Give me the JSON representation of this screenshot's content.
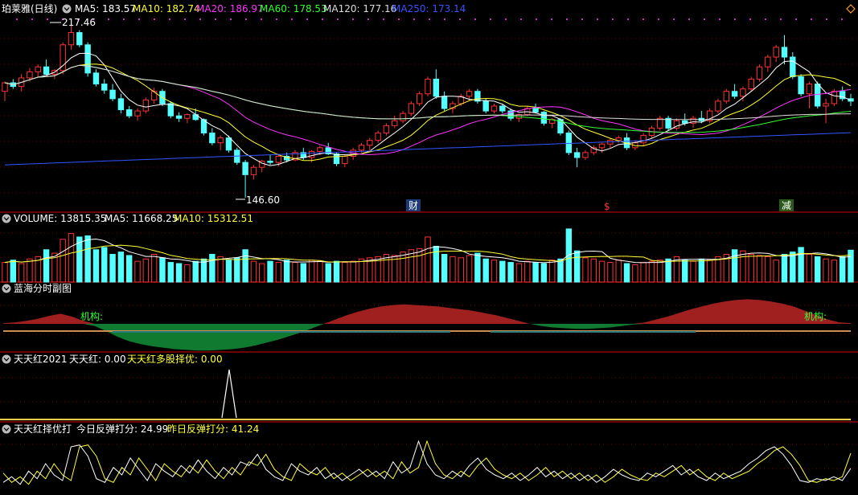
{
  "panels": {
    "price": {
      "name": "珀莱雅(日线)",
      "ma": [
        {
          "label": "MA5: 183.57",
          "color": "#ffffff"
        },
        {
          "label": "MA10: 182.74",
          "color": "#ffff33"
        },
        {
          "label": "MA20: 186.97",
          "color": "#ff33ff"
        },
        {
          "label": "MA60: 178.53",
          "color": "#33ff33"
        },
        {
          "label": "MA120: 177.16",
          "color": "#dddddd"
        },
        {
          "label": "MA250: 173.14",
          "color": "#3355ff"
        }
      ],
      "high_label": "217.46",
      "low_label": "146.60",
      "events": [
        "财",
        "$",
        "减"
      ]
    },
    "volume": {
      "name": "VOLUME: 13815.35",
      "ma5": "MA5: 11668.25",
      "ma10": "MA10: 15312.51"
    },
    "lanhai": {
      "name": "蓝海分时副图",
      "tag_left": "机构:",
      "tag_right": "机构:"
    },
    "tth": {
      "name": "天天红2021",
      "v1": "天天红: 0.00",
      "v2": "天天红多股择优: 0.00"
    },
    "ttx": {
      "name": "天天红择优打",
      "v1": "今日反弹打分: 24.99",
      "v2": "昨日反弹打分: 41.24"
    }
  },
  "colors": {
    "up": "#ff3232",
    "down": "#54ffff",
    "grid": "#7a0000",
    "ma5": "#ffffff",
    "ma10": "#ffff33",
    "ma20": "#ff33ff",
    "ma60": "#33ff33",
    "ma120": "#dddddd",
    "ma250": "#3355ff",
    "red_area": "#a02020",
    "green_area": "#107a30"
  },
  "chart_data": {
    "type": "candlestick",
    "ylim": [
      146.6,
      217.46
    ],
    "candles": [
      [
        190.0,
        194.0,
        186.0,
        193.5
      ],
      [
        193.5,
        195.0,
        191.0,
        192.0
      ],
      [
        192.0,
        197.0,
        190.0,
        195.5
      ],
      [
        195.5,
        199.5,
        194.0,
        198.0
      ],
      [
        198.0,
        201.0,
        196.0,
        200.0
      ],
      [
        200.0,
        203.0,
        196.5,
        197.0
      ],
      [
        197.0,
        199.0,
        195.0,
        198.5
      ],
      [
        198.5,
        210.0,
        197.0,
        209.0
      ],
      [
        209.0,
        217.46,
        207.0,
        214.0
      ],
      [
        214.0,
        215.0,
        208.0,
        209.0
      ],
      [
        209.0,
        210.0,
        196.0,
        197.5
      ],
      [
        197.5,
        199.0,
        192.0,
        193.0
      ],
      [
        193.0,
        195.0,
        189.0,
        190.5
      ],
      [
        190.5,
        193.0,
        186.0,
        187.0
      ],
      [
        187.0,
        189.0,
        181.0,
        182.5
      ],
      [
        182.5,
        184.0,
        179.0,
        180.0
      ],
      [
        180.0,
        183.0,
        178.0,
        182.0
      ],
      [
        182.0,
        187.5,
        181.0,
        186.5
      ],
      [
        186.5,
        191.5,
        185.0,
        190.0
      ],
      [
        190.0,
        191.0,
        184.0,
        185.0
      ],
      [
        185.0,
        186.0,
        179.0,
        180.0
      ],
      [
        180.0,
        181.5,
        177.5,
        179.0
      ],
      [
        179.0,
        181.0,
        177.0,
        180.5
      ],
      [
        180.5,
        183.0,
        178.0,
        178.5
      ],
      [
        178.5,
        179.0,
        172.0,
        173.0
      ],
      [
        173.0,
        175.0,
        168.0,
        169.0
      ],
      [
        169.0,
        172.0,
        166.0,
        171.0
      ],
      [
        171.0,
        172.0,
        165.0,
        166.0
      ],
      [
        166.0,
        167.0,
        160.0,
        161.0
      ],
      [
        161.0,
        162.0,
        146.6,
        156.0
      ],
      [
        156.0,
        160.0,
        154.0,
        159.0
      ],
      [
        159.0,
        162.0,
        157.0,
        161.5
      ],
      [
        161.5,
        164.0,
        160.0,
        161.0
      ],
      [
        161.0,
        164.5,
        159.5,
        163.5
      ],
      [
        163.5,
        165.0,
        161.0,
        162.0
      ],
      [
        162.0,
        166.0,
        161.5,
        165.0
      ],
      [
        165.0,
        167.0,
        162.0,
        163.0
      ],
      [
        163.0,
        166.0,
        161.0,
        165.5
      ],
      [
        165.5,
        168.0,
        164.0,
        167.0
      ],
      [
        167.0,
        169.0,
        164.0,
        164.5
      ],
      [
        164.5,
        165.0,
        159.5,
        160.5
      ],
      [
        160.5,
        164.0,
        159.0,
        163.5
      ],
      [
        163.5,
        167.0,
        162.0,
        166.0
      ],
      [
        166.0,
        169.0,
        165.0,
        168.0
      ],
      [
        168.0,
        171.0,
        166.0,
        170.0
      ],
      [
        170.0,
        174.0,
        169.0,
        173.0
      ],
      [
        173.0,
        177.0,
        172.0,
        176.0
      ],
      [
        176.0,
        180.0,
        175.0,
        178.0
      ],
      [
        178.0,
        182.0,
        177.0,
        181.0
      ],
      [
        181.0,
        186.0,
        180.0,
        185.0
      ],
      [
        185.0,
        190.0,
        184.0,
        189.0
      ],
      [
        189.0,
        196.0,
        188.0,
        195.0
      ],
      [
        195.0,
        199.0,
        187.0,
        188.0
      ],
      [
        188.0,
        190.0,
        182.0,
        183.0
      ],
      [
        183.0,
        186.0,
        181.0,
        185.0
      ],
      [
        185.0,
        189.0,
        184.0,
        188.0
      ],
      [
        188.0,
        191.0,
        186.0,
        190.0
      ],
      [
        190.0,
        191.0,
        185.0,
        186.0
      ],
      [
        186.0,
        187.0,
        181.0,
        182.0
      ],
      [
        182.0,
        185.0,
        181.0,
        184.0
      ],
      [
        184.0,
        185.0,
        181.0,
        182.0
      ],
      [
        182.0,
        183.0,
        178.0,
        179.0
      ],
      [
        179.0,
        181.0,
        177.5,
        180.5
      ],
      [
        180.5,
        184.0,
        180.0,
        183.0
      ],
      [
        183.0,
        185.0,
        181.0,
        181.5
      ],
      [
        181.5,
        182.0,
        176.0,
        177.0
      ],
      [
        177.0,
        179.0,
        175.0,
        178.5
      ],
      [
        178.5,
        179.0,
        172.0,
        173.0
      ],
      [
        173.0,
        174.0,
        164.0,
        165.0
      ],
      [
        165.0,
        167.0,
        159.0,
        163.0
      ],
      [
        163.0,
        166.0,
        162.0,
        165.0
      ],
      [
        165.0,
        168.0,
        164.0,
        167.0
      ],
      [
        167.0,
        169.0,
        165.0,
        168.5
      ],
      [
        168.5,
        171.0,
        167.0,
        170.0
      ],
      [
        170.0,
        172.0,
        169.0,
        171.0
      ],
      [
        171.0,
        173.0,
        166.0,
        167.0
      ],
      [
        167.0,
        170.0,
        166.0,
        169.0
      ],
      [
        169.0,
        173.0,
        168.0,
        172.0
      ],
      [
        172.0,
        176.0,
        171.0,
        175.0
      ],
      [
        175.0,
        180.0,
        174.0,
        179.0
      ],
      [
        179.0,
        180.0,
        174.0,
        175.0
      ],
      [
        175.0,
        179.0,
        174.0,
        178.0
      ],
      [
        178.0,
        181.0,
        176.0,
        177.0
      ],
      [
        177.0,
        180.0,
        175.0,
        179.0
      ],
      [
        179.0,
        182.0,
        177.0,
        178.0
      ],
      [
        178.0,
        183.0,
        177.0,
        182.0
      ],
      [
        182.0,
        187.0,
        181.0,
        186.0
      ],
      [
        186.0,
        191.0,
        185.0,
        190.0
      ],
      [
        190.0,
        193.0,
        187.0,
        188.0
      ],
      [
        188.0,
        192.0,
        186.0,
        191.0
      ],
      [
        191.0,
        196.0,
        190.0,
        195.0
      ],
      [
        195.0,
        201.0,
        194.0,
        200.0
      ],
      [
        200.0,
        205.0,
        198.0,
        204.0
      ],
      [
        204.0,
        209.0,
        202.0,
        208.0
      ],
      [
        208.0,
        213.0,
        201.0,
        204.0
      ],
      [
        204.0,
        206.0,
        195.0,
        196.0
      ],
      [
        196.0,
        197.0,
        188.0,
        189.0
      ],
      [
        189.0,
        194.0,
        183.0,
        193.0
      ],
      [
        193.0,
        194.0,
        183.0,
        184.0
      ],
      [
        184.0,
        187.0,
        177.0,
        185.0
      ],
      [
        185.0,
        191.0,
        184.0,
        190.0
      ],
      [
        190.0,
        192.0,
        186.0,
        187.0
      ],
      [
        187.0,
        189.0,
        184.0,
        186.0
      ]
    ],
    "volume": [
      8500,
      9500,
      8000,
      10000,
      11000,
      14000,
      12500,
      18500,
      21000,
      19500,
      20000,
      14000,
      15000,
      12000,
      13000,
      11500,
      9000,
      10000,
      12000,
      10500,
      8500,
      8000,
      7500,
      9000,
      10000,
      12000,
      11000,
      9500,
      10500,
      14000,
      9000,
      8000,
      9000,
      8500,
      9500,
      8500,
      8000,
      9500,
      9000,
      8000,
      9000,
      8500,
      9000,
      10000,
      10500,
      11000,
      12000,
      11500,
      13000,
      14000,
      14500,
      19500,
      15500,
      12000,
      11000,
      10500,
      11500,
      12500,
      10000,
      9500,
      9000,
      8500,
      8000,
      9000,
      8500,
      8000,
      9500,
      10000,
      23000,
      13500,
      10500,
      10000,
      9000,
      8500,
      9500,
      8000,
      7500,
      8500,
      9000,
      9500,
      10000,
      11000,
      9500,
      9000,
      10000,
      9500,
      11000,
      12000,
      14000,
      13500,
      12000,
      11500,
      11000,
      9500,
      12000,
      13000,
      15000,
      12000,
      11000,
      10000,
      9500,
      11000,
      13815.35
    ],
    "lanhai": [
      1,
      2,
      4,
      7,
      11,
      14,
      10,
      4,
      -3,
      -10,
      -18,
      -24,
      -28,
      -31,
      -33,
      -35,
      -36,
      -37,
      -37,
      -36,
      -35,
      -33,
      -30,
      -26,
      -22,
      -17,
      -12,
      -6,
      0,
      6,
      12,
      17,
      21,
      24,
      26,
      27,
      26,
      25,
      24,
      22,
      20,
      18,
      15,
      12,
      8,
      4,
      0,
      -3,
      -5,
      -6,
      -7,
      -7,
      -6,
      -5,
      -3,
      -1,
      2,
      6,
      10,
      15,
      20,
      24,
      28,
      31,
      33,
      34,
      33,
      31,
      28,
      24,
      18,
      12,
      6,
      2,
      1
    ],
    "tth": [
      0,
      0,
      0,
      0,
      0,
      0,
      0,
      0,
      0,
      0,
      0,
      0,
      0,
      0,
      0,
      0,
      0,
      0,
      0,
      0,
      0,
      0,
      0,
      0,
      0,
      0,
      0,
      0,
      0,
      0,
      0,
      0,
      0,
      0,
      0,
      0,
      0,
      0,
      0,
      0,
      0,
      0,
      0,
      0,
      0,
      0,
      0,
      0,
      0,
      0,
      0,
      0,
      0,
      0,
      0,
      0,
      0,
      0,
      0,
      0,
      0,
      0,
      0,
      0,
      0,
      0,
      0,
      0,
      0,
      0,
      0,
      0,
      0,
      0,
      0,
      0,
      0,
      0,
      0,
      0,
      0,
      0,
      0,
      0,
      0,
      0,
      0,
      0,
      0,
      0,
      0,
      0,
      0,
      0,
      0,
      0,
      0,
      0,
      0,
      0,
      0,
      0,
      0,
      0,
      0,
      0,
      0,
      0,
      0,
      0,
      0,
      0,
      0,
      0,
      0,
      0,
      0,
      0,
      0,
      0,
      0,
      0,
      0,
      0,
      0,
      0,
      0,
      0,
      0,
      0,
      0,
      0,
      0,
      0,
      0,
      0,
      0,
      0,
      0,
      0,
      0,
      0,
      0,
      0,
      0,
      0,
      0,
      0,
      0,
      0,
      0,
      0,
      0,
      0,
      0,
      0,
      0,
      0,
      0,
      0,
      0,
      0,
      0,
      0,
      0,
      0,
      0,
      0,
      0,
      0,
      0,
      0,
      0,
      0,
      0,
      0,
      0,
      0,
      0,
      0,
      0,
      0,
      0,
      0,
      0,
      0,
      0,
      0,
      0,
      0,
      0,
      0,
      0,
      0,
      0,
      0,
      0,
      0,
      0,
      0,
      0,
      0,
      0,
      0,
      0,
      0,
      0,
      0,
      0,
      0,
      0,
      0,
      0,
      0,
      0,
      0,
      0,
      0,
      0,
      0,
      0,
      0,
      0,
      0,
      0,
      0,
      0,
      0,
      0,
      0,
      0,
      0,
      0,
      0,
      0,
      0,
      0,
      0,
      0,
      0,
      0,
      0,
      0,
      0,
      0,
      0,
      0,
      0,
      0,
      0,
      0,
      0,
      0,
      0,
      0,
      0,
      0,
      0,
      0,
      0,
      0,
      0,
      0,
      0,
      0,
      0,
      0,
      0,
      0,
      0,
      0,
      0,
      0,
      0,
      0,
      0,
      0,
      0,
      0,
      0,
      0,
      0,
      0,
      0,
      0,
      0,
      0,
      0,
      0,
      0,
      0,
      0,
      0,
      0,
      0,
      0,
      0,
      0,
      0,
      0,
      0,
      0,
      0,
      0,
      0,
      0,
      0,
      0,
      0,
      0,
      0,
      0,
      0,
      0,
      0,
      0,
      0,
      0,
      0,
      0,
      0,
      0,
      0,
      0,
      0,
      0,
      0,
      0,
      0,
      0,
      0,
      0,
      0,
      0,
      0,
      0,
      0,
      0,
      0,
      0,
      0,
      0,
      0,
      0,
      0,
      0,
      0,
      0,
      0,
      0,
      0,
      0,
      0,
      0,
      0,
      0,
      0,
      0,
      0,
      0,
      0,
      0,
      0,
      0,
      0,
      0,
      0,
      0,
      0,
      0,
      0,
      0,
      0,
      0,
      0,
      0,
      0,
      0,
      0,
      0,
      0,
      0,
      0,
      0,
      0,
      0,
      0,
      0,
      0,
      0,
      0,
      0,
      0,
      0,
      0,
      0,
      0,
      0,
      0,
      0,
      0,
      0,
      0,
      0,
      0,
      0,
      0,
      0,
      0,
      0,
      0,
      0,
      0,
      0,
      0,
      0,
      0,
      0,
      0,
      0,
      0,
      0,
      0,
      0,
      0,
      0,
      0,
      0,
      0,
      0,
      0,
      0,
      0,
      0,
      0,
      0,
      0,
      0,
      0,
      0,
      0,
      0,
      0,
      0,
      0,
      0,
      0,
      0,
      0,
      0,
      0,
      0,
      0,
      0,
      0,
      0,
      0,
      0,
      0,
      0,
      0,
      0,
      0,
      0,
      0,
      0,
      0,
      0,
      0,
      0,
      0,
      0,
      0,
      0,
      0,
      0,
      0,
      0,
      0,
      0,
      0,
      0,
      0,
      0,
      0,
      0,
      0,
      0,
      0,
      0,
      0,
      0,
      0,
      0,
      0,
      0,
      0,
      0,
      0,
      0,
      0,
      0,
      0,
      0,
      0,
      0,
      0,
      0,
      0,
      0,
      0,
      0,
      0,
      0,
      0,
      0,
      0,
      0,
      0,
      0,
      0,
      0,
      0,
      0,
      0,
      0,
      0,
      0,
      0,
      0,
      0,
      0,
      0,
      0,
      0,
      0,
      0,
      0,
      0,
      0,
      0,
      0,
      0,
      0,
      0,
      0,
      0,
      0,
      0,
      0,
      0,
      0,
      0,
      0,
      0,
      0,
      0,
      0,
      0,
      0
    ],
    "ttx_today": [
      10,
      16,
      8,
      22,
      14,
      30,
      18,
      12,
      48,
      50,
      38,
      14,
      10,
      26,
      18,
      36,
      24,
      12,
      30,
      22,
      16,
      28,
      20,
      34,
      22,
      14,
      26,
      18,
      32,
      28,
      40,
      24,
      16,
      12,
      30,
      22,
      18,
      26,
      14,
      20,
      12,
      18,
      24,
      16,
      22,
      14,
      32,
      20,
      26,
      54,
      30,
      18,
      14,
      22,
      16,
      28,
      36,
      24,
      18,
      14,
      20,
      12,
      18,
      26,
      16,
      22,
      14,
      20,
      12,
      18,
      10,
      16,
      24,
      18,
      14,
      12,
      20,
      16,
      22,
      28,
      18,
      24,
      16,
      12,
      20,
      14,
      18,
      22,
      30,
      36,
      44,
      48,
      40,
      28,
      12,
      10,
      14,
      12,
      16,
      12,
      24.99
    ],
    "ttx_yesterday": [
      20,
      10,
      16,
      8,
      22,
      14,
      30,
      18,
      12,
      48,
      50,
      38,
      14,
      10,
      26,
      18,
      36,
      24,
      12,
      30,
      22,
      16,
      28,
      20,
      34,
      22,
      14,
      26,
      18,
      32,
      28,
      40,
      24,
      16,
      12,
      30,
      22,
      18,
      26,
      14,
      20,
      12,
      18,
      24,
      16,
      22,
      14,
      32,
      20,
      26,
      54,
      30,
      18,
      14,
      22,
      16,
      28,
      36,
      24,
      18,
      14,
      20,
      12,
      18,
      26,
      16,
      22,
      14,
      20,
      12,
      18,
      10,
      16,
      24,
      18,
      14,
      12,
      20,
      16,
      22,
      28,
      18,
      24,
      16,
      12,
      20,
      14,
      18,
      22,
      30,
      36,
      44,
      48,
      40,
      28,
      12,
      10,
      14,
      12,
      16,
      41.24
    ]
  }
}
